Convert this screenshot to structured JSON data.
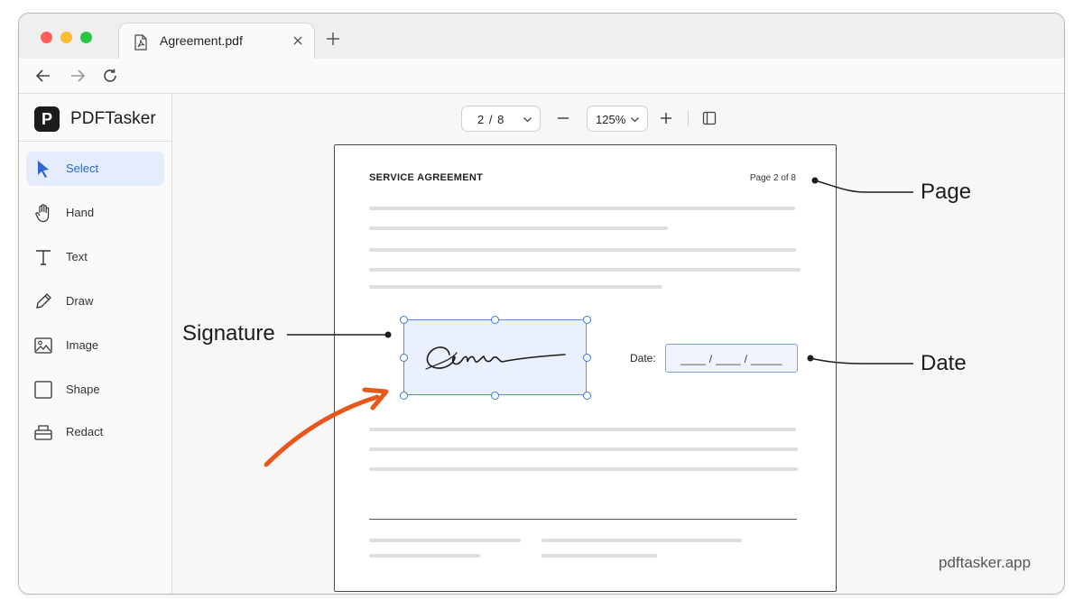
{
  "browser": {
    "tab_title": "Agreement.pdf",
    "icons": {
      "tab": "pdf-file-icon",
      "close": "close-icon",
      "new_tab": "plus-icon",
      "back": "arrow-left-icon",
      "forward": "arrow-right-icon",
      "reload": "reload-icon"
    }
  },
  "app": {
    "logo_letter": "P",
    "name": "PDFTasker",
    "tools": [
      {
        "label": "Select",
        "icon": "cursor-icon",
        "active": true
      },
      {
        "label": "Hand",
        "icon": "hand-icon",
        "active": false
      },
      {
        "label": "Text",
        "icon": "text-icon",
        "active": false
      },
      {
        "label": "Draw",
        "icon": "pencil-icon",
        "active": false
      },
      {
        "label": "Image",
        "icon": "image-icon",
        "active": false
      },
      {
        "label": "Shape",
        "icon": "square-icon",
        "active": false
      },
      {
        "label": "Redact",
        "icon": "redact-icon",
        "active": false
      }
    ],
    "accent_color": "#2f66d0"
  },
  "toolbar": {
    "page_selector": "2 / 8",
    "zoom": "125%",
    "icons": {
      "zoom_out": "minus-icon",
      "zoom_in": "plus-icon",
      "sidebar_toggle": "sidebar-panel-icon",
      "dropdown": "chevron-down-icon"
    }
  },
  "document": {
    "title": "SERVICE AGREEMENT",
    "page_label": "Page 2 of 8",
    "date_label": "Date:",
    "date_placeholder": "____ / ____ / _____"
  },
  "callouts": {
    "page": "Page",
    "signature": "Signature",
    "date": "Date",
    "arrow_color": "#e8581c"
  },
  "watermark": "pdftasker.app"
}
